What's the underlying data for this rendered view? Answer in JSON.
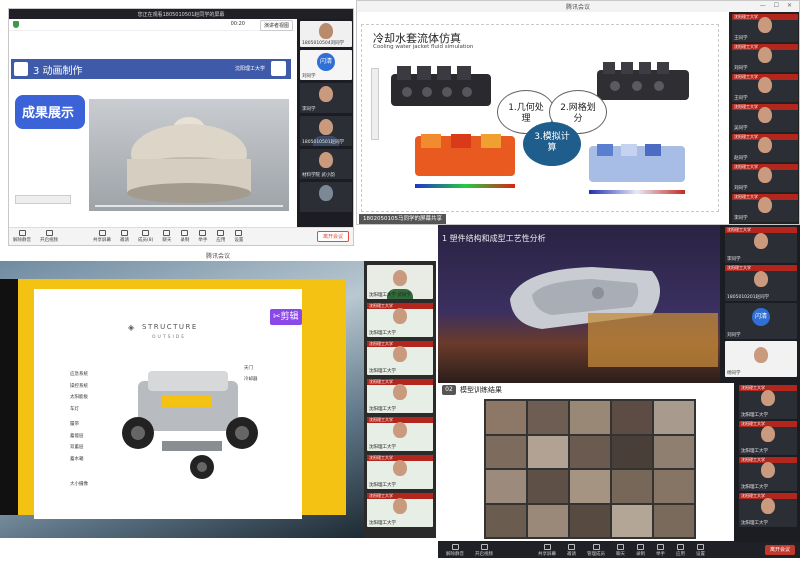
{
  "win1": {
    "title": "您正在观看1805010501赵同学的屏幕",
    "timer": "00:20",
    "view_btn": "演讲者视图",
    "slide_header": "3 动画制作",
    "school": "沈阳理工大学",
    "results_text": "成果展示",
    "toolbar": [
      "解除静音",
      "开启视频",
      "共享屏幕",
      "邀请",
      "成员(8)",
      "聊天",
      "录制",
      "举手",
      "应用",
      "设置"
    ],
    "leave": "离开会议",
    "participants": [
      "1805010504刘同学",
      "刘同学",
      "李同学",
      "1805010501赵同学",
      "材料学院 武小韵"
    ],
    "chip": "闪清"
  },
  "win2": {
    "title": "腾讯会议",
    "slide_title": "冷却水套流体仿真",
    "slide_subtitle": "Cooling water jacket fluid simulation",
    "step1": "1.几何处理",
    "step2": "2.网格划分",
    "step3": "3.模拟计算",
    "caption": "1802050105马同学的屏幕共享",
    "participants": [
      "王同学",
      "刘同学",
      "王同学",
      "吴同学",
      "赵同学",
      "刘同学",
      "李同学"
    ]
  },
  "win3": {
    "title": "腾讯会议",
    "watermark": "剪辑",
    "structure_title": "STRUCTURE",
    "structure_sub": "OUTSIDE",
    "labels_left": [
      "应急系统",
      "操控系统",
      "太阳能板",
      "车灯",
      "履带",
      "蓄能层",
      "双蓄层",
      "蓄水箱",
      "大小摄像"
    ],
    "labels_right": [
      "天门",
      "冷却器"
    ],
    "participants": [
      "沈阳理工大学 武同学",
      "沈阳理工大学",
      "沈阳理工大学",
      "沈阳理工大学",
      "沈阳理工大学",
      "沈阳理工大学",
      "沈阳理工大学"
    ]
  },
  "win4": {
    "slide_title": "1 塑件结构和成型工艺性分析",
    "participants": [
      "李同学",
      "1805010201赵同学",
      "刘同学",
      "杨同学"
    ],
    "chip": "闪清"
  },
  "win5": {
    "section_no": "02",
    "section_title": "模型训练结果",
    "toolbar": [
      "解除静音",
      "开启视频",
      "共享屏幕",
      "邀请",
      "管理成员",
      "聊天",
      "录制",
      "举手",
      "应用",
      "设置"
    ],
    "leave": "离开会议",
    "participants": [
      "沈阳理工大学",
      "沈阳理工大学",
      "沈阳理工大学",
      "沈阳理工大学"
    ]
  },
  "colors": {
    "tencent_blue": "#2f6fd6",
    "leave_red": "#e04a3f",
    "slide_blue": "#3e5aa8",
    "yellow_frame": "#f3c212"
  }
}
